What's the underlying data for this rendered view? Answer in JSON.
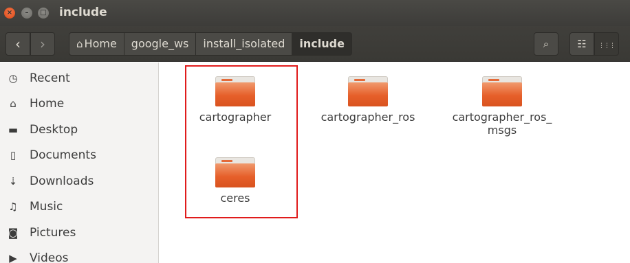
{
  "window": {
    "title": "include",
    "close_glyph": "×",
    "minimize_glyph": "–",
    "maximize_glyph": "□"
  },
  "toolbar": {
    "back_glyph": "‹",
    "forward_glyph": "›",
    "breadcrumbs": [
      {
        "label": "Home",
        "icon": "home-icon"
      },
      {
        "label": "google_ws"
      },
      {
        "label": "install_isolated"
      },
      {
        "label": "include",
        "active": true
      }
    ],
    "search_glyph": "⌕",
    "list_glyph": "☷",
    "grid_glyph": "⋮⋮⋮"
  },
  "sidebar": {
    "items": [
      {
        "label": "Recent",
        "icon": "clock-icon",
        "glyph": "◷"
      },
      {
        "label": "Home",
        "icon": "home-icon",
        "glyph": "⌂"
      },
      {
        "label": "Desktop",
        "icon": "folder-icon",
        "glyph": "▬"
      },
      {
        "label": "Documents",
        "icon": "document-icon",
        "glyph": "▯"
      },
      {
        "label": "Downloads",
        "icon": "download-icon",
        "glyph": "⇣"
      },
      {
        "label": "Music",
        "icon": "music-icon",
        "glyph": "♫"
      },
      {
        "label": "Pictures",
        "icon": "camera-icon",
        "glyph": "◙"
      },
      {
        "label": "Videos",
        "icon": "video-icon",
        "glyph": "▶"
      }
    ]
  },
  "files": [
    {
      "name": "cartographer",
      "icon": "folder-icon"
    },
    {
      "name": "cartographer_ros",
      "icon": "folder-icon"
    },
    {
      "name": "cartographer_ros_\nmsgs",
      "icon": "folder-icon"
    },
    {
      "name": "ceres",
      "icon": "folder-icon"
    }
  ],
  "colors": {
    "folder": "#e65f2a",
    "highlight_box": "#e01b1b",
    "titlebar": "#3d3c39",
    "close_button": "#dd4814"
  }
}
